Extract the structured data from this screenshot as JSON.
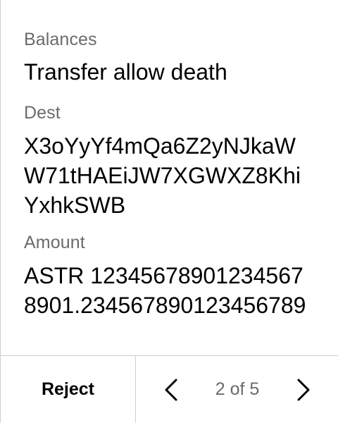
{
  "review": {
    "fields": [
      {
        "label": "Balances",
        "value": "Transfer allow death"
      },
      {
        "label": "Dest",
        "value": "X3oYyYf4mQa6Z2yNJkaWW71tHAEiJW7XGWXZ8KhiYxhkSWB"
      },
      {
        "label": "Amount",
        "value": "ASTR 123456789012345678901.234567890123456789"
      }
    ]
  },
  "footer": {
    "reject_label": "Reject",
    "pagination": "2 of 5",
    "prev_icon": "chevron-left-icon",
    "next_icon": "chevron-right-icon"
  },
  "colors": {
    "text": "#000000",
    "label": "#6b6b6b",
    "divider": "#cfcfcf",
    "background": "#ffffff"
  }
}
